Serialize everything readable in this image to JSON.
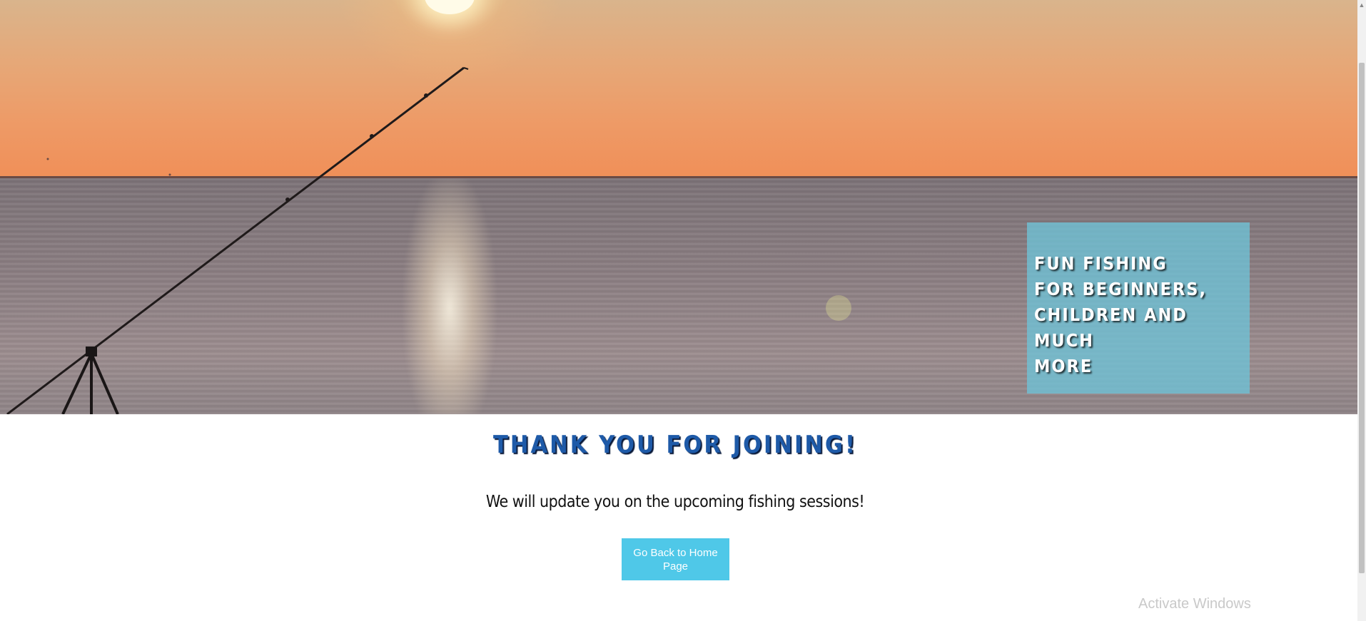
{
  "hero": {
    "box_lines": [
      "FUN FISHING",
      "FOR BEGINNERS,",
      "CHILDREN AND MUCH",
      "MORE"
    ]
  },
  "content": {
    "heading": "THANK YOU FOR JOINING!",
    "message": "We will update you on the upcoming fishing sessions!",
    "home_button_label": "Go Back to Home Page"
  },
  "overlay": {
    "watermark": "Activate Windows"
  },
  "colors": {
    "heading": "#1e5aa8",
    "button": "#4fc8e8",
    "hero_box": "#6ec3d7"
  },
  "icons": {
    "scroll_up": "chevron-up-icon"
  }
}
